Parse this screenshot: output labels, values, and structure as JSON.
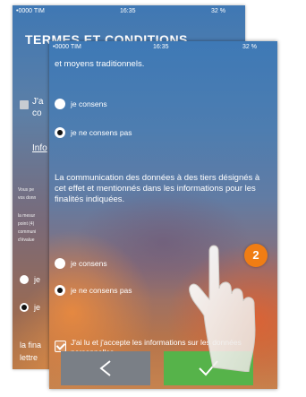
{
  "back_screen": {
    "status": {
      "carrier": "•0000 TIM",
      "time": "16:35",
      "battery": "32 %"
    },
    "title": "TERMES ET CONDITIONS",
    "checkbox_text_line1": "J'a",
    "checkbox_text_line2": "co",
    "info_link": "Info",
    "small_lines": [
      "Vous pe",
      "vos donn",
      "la mesur",
      "point (4)",
      "communi",
      "d'évalue"
    ],
    "radio_labels": [
      "je",
      "je"
    ],
    "bottom_lines": [
      "la fina",
      "lettre"
    ]
  },
  "front_screen": {
    "status": {
      "carrier": "•0000 TIM",
      "time": "16:35",
      "battery": "32 %"
    },
    "top_text": "et moyens traditionnels.",
    "group1": [
      {
        "label": "je consens",
        "selected": false
      },
      {
        "label": "je ne consens pas",
        "selected": true
      }
    ],
    "paragraph": "La communication des données à des tiers désignés à cet effet et mentionnés dans les informations pour les finalités indiquées.",
    "group2": [
      {
        "label": "je consens",
        "selected": false
      },
      {
        "label": "je ne consens pas",
        "selected": true
      }
    ],
    "accept_text": "J'ai lu et j'accepte les informations sur les données personnelles.",
    "buttons": {
      "back_icon": "chevron-left-icon",
      "confirm_icon": "checkmark-icon"
    }
  },
  "callout": {
    "number": "2",
    "color": "#f07d14"
  },
  "colors": {
    "confirm_button": "#56b34a",
    "back_button": "#7a7f86"
  }
}
